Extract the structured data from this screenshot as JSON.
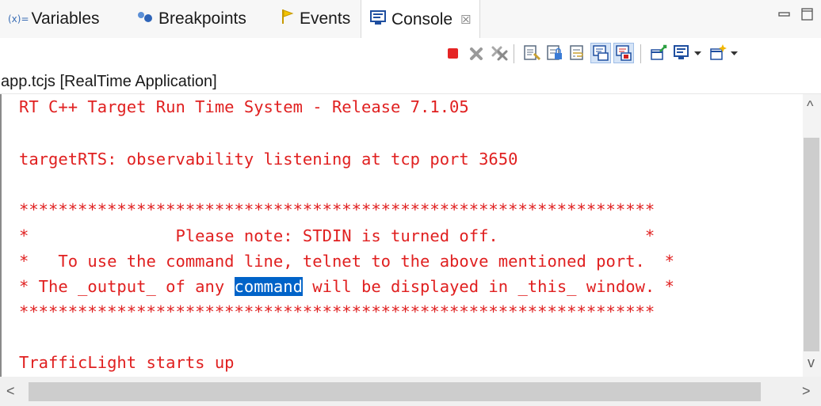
{
  "tabs": [
    {
      "label": "Variables",
      "icon": "variables-icon",
      "icon_text": "(x)="
    },
    {
      "label": "Breakpoints",
      "icon": "breakpoints-icon"
    },
    {
      "label": "Events",
      "icon": "events-icon"
    },
    {
      "label": "Console",
      "icon": "console-icon",
      "active": true,
      "close": "☒"
    }
  ],
  "toolbar": {
    "buttons": [
      "terminate-icon",
      "remove-launch-icon",
      "remove-all-terminated-icon",
      "clear-console-icon",
      "scroll-lock-icon",
      "word-wrap-icon",
      "show-on-stdout-icon",
      "show-on-stderr-icon",
      "pin-console-icon",
      "display-selected-console-icon",
      "open-console-icon"
    ]
  },
  "process_label": "app.tcjs [RealTime Application]",
  "console": {
    "lines": [
      "RT C++ Target Run Time System - Release 7.1.05",
      "",
      "targetRTS: observability listening at tcp port 3650",
      "",
      "*****************************************************************",
      "*               Please note: STDIN is turned off.               *",
      "*   To use the command line, telnet to the above mentioned port.  *",
      "",
      "*****************************************************************",
      "",
      "",
      "TrafficLight starts up"
    ],
    "selected_line": {
      "before": "* The _output_ of any ",
      "selected": "command",
      "after": " will be displayed in _this_ window. *"
    },
    "text_color": "#e02020",
    "selection_color": "#0063c8"
  },
  "scroll": {
    "up": "^",
    "down": "v",
    "left": "<",
    "right": ">"
  }
}
